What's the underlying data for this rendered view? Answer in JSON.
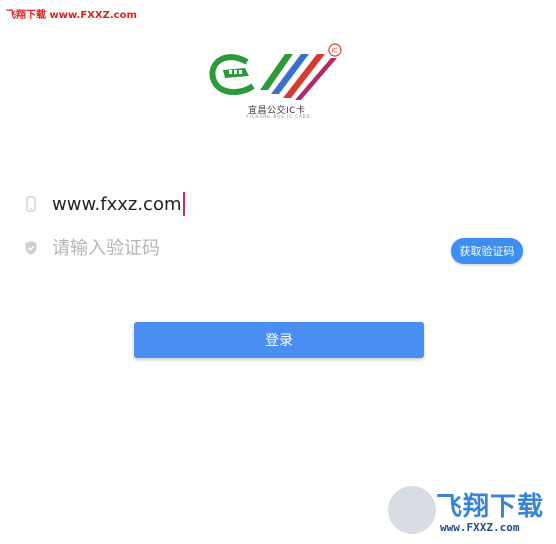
{
  "watermark": {
    "top_text": "飞翔下载 www.FXXZ.com"
  },
  "logo": {
    "title": "宜昌公交IC卡",
    "subtitle": "YICHANG BUS IC CARD",
    "badge": "IC"
  },
  "form": {
    "phone_value": "www.fxxz.com",
    "phone_icon": "phone-icon",
    "code_placeholder": "请输入验证码",
    "code_icon": "shield-icon",
    "get_code_label": "获取验证码",
    "login_label": "登录"
  },
  "badge": {
    "title": "飞翔下载",
    "url": "www.FXXZ.com"
  },
  "colors": {
    "primary": "#4a8df3",
    "caret": "#e0206a",
    "watermark": "#e0201c"
  }
}
